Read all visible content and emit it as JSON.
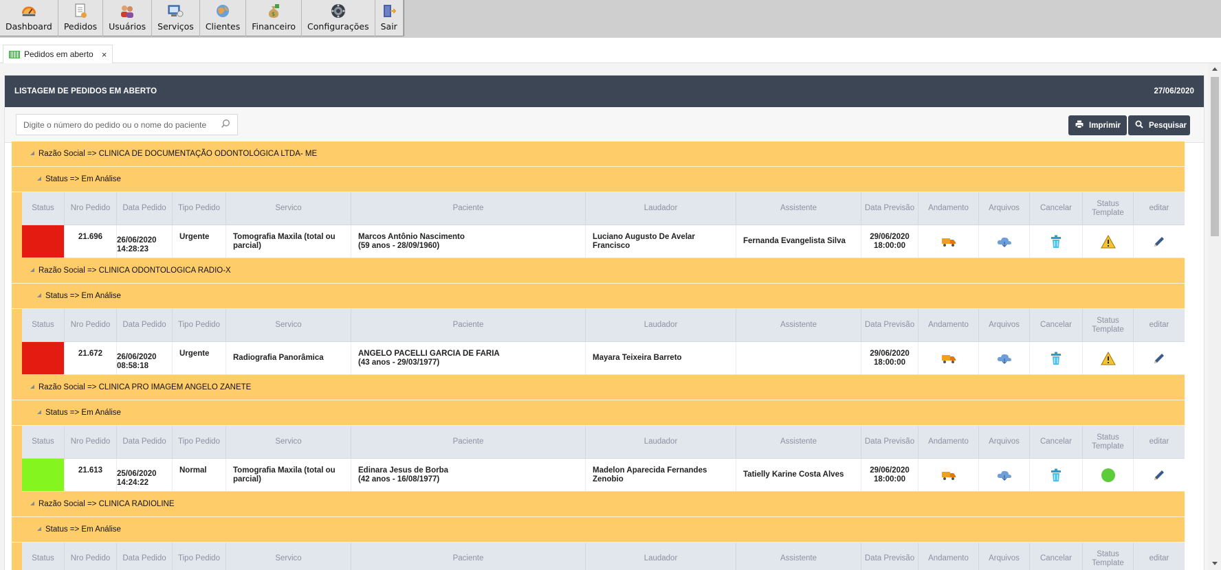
{
  "menu": [
    {
      "label": "Dashboard",
      "icon": "dashboard-icon"
    },
    {
      "label": "Pedidos",
      "icon": "document-icon"
    },
    {
      "label": "Usuários",
      "icon": "users-icon"
    },
    {
      "label": "Serviços",
      "icon": "services-icon"
    },
    {
      "label": "Clientes",
      "icon": "globe-icon"
    },
    {
      "label": "Financeiro",
      "icon": "money-bag-icon"
    },
    {
      "label": "Configurações",
      "icon": "settings-icon"
    },
    {
      "label": "Sair",
      "icon": "exit-door-icon"
    }
  ],
  "tab": {
    "label": "Pedidos em aberto",
    "close": "×"
  },
  "header": {
    "title": "LISTAGEM DE PEDIDOS EM ABERTO",
    "date": "27/06/2020"
  },
  "search": {
    "placeholder": "Digite o número do pedido ou o nome do paciente"
  },
  "buttons": {
    "print": "Imprimir",
    "search": "Pesquisar"
  },
  "columns": {
    "status": "Status",
    "nro": "Nro Pedido",
    "data": "Data Pedido",
    "tipo": "Tipo Pedido",
    "servico": "Servico",
    "paciente": "Paciente",
    "laudador": "Laudador",
    "assistente": "Assistente",
    "previsao": "Data Previsão",
    "andamento": "Andamento",
    "arquivos": "Arquivos",
    "cancelar": "Cancelar",
    "status_template": "Status Template",
    "editar": "editar"
  },
  "colors": {
    "header_bg": "#3c4654",
    "group_bg": "#ffcc6a",
    "status_red": "#e31b10",
    "status_green": "#85f520"
  },
  "groups": [
    {
      "razao": "Razão Social => CLINICA DE DOCUMENTAÇÃO ODONTOLÓGICA LTDA- ME",
      "status": "Status => Em Análise",
      "row": {
        "status_color": "red",
        "nro": "21.696",
        "data": "26/06/2020",
        "hora": "14:28:23",
        "tipo": "Urgente",
        "servico": "Tomografia Maxila (total ou parcial)",
        "paciente": "Marcos Antônio Nascimento",
        "paciente_info": "(59 anos - 28/09/1960)",
        "laudador": "Luciano Augusto De Avelar Francisco",
        "assistente": "Fernanda Evangelista Silva",
        "previsao": "29/06/2020",
        "previsao_hora": "18:00:00",
        "template_icon": "warning-icon"
      }
    },
    {
      "razao": "Razão Social => CLINICA ODONTOLOGICA RADIO-X",
      "status": "Status => Em Análise",
      "row": {
        "status_color": "red",
        "nro": "21.672",
        "data": "26/06/2020",
        "hora": "08:58:18",
        "tipo": "Urgente",
        "servico": "Radiografia Panorâmica",
        "paciente": "ANGELO PACELLI GARCIA DE FARIA",
        "paciente_info": "(43 anos - 29/03/1977)",
        "laudador": "Mayara Teixeira Barreto",
        "assistente": "",
        "previsao": "29/06/2020",
        "previsao_hora": "18:00:00",
        "template_icon": "warning-icon"
      }
    },
    {
      "razao": "Razão Social => CLINICA PRO IMAGEM ANGELO ZANETE",
      "status": "Status => Em Análise",
      "row": {
        "status_color": "green",
        "nro": "21.613",
        "data": "25/06/2020",
        "hora": "14:24:22",
        "tipo": "Normal",
        "servico": "Tomografia Maxila (total ou parcial)",
        "paciente": "Edinara Jesus de Borba",
        "paciente_info": "(42 anos - 16/08/1977)",
        "laudador": "Madelon Aparecida Fernandes Zenobio",
        "assistente": "Tatielly Karine Costa Alves",
        "previsao": "29/06/2020",
        "previsao_hora": "18:00:00",
        "template_icon": "green-circle-icon"
      }
    },
    {
      "razao": "Razão Social => CLINICA RADIOLINE",
      "status": "Status => Em Análise"
    }
  ]
}
